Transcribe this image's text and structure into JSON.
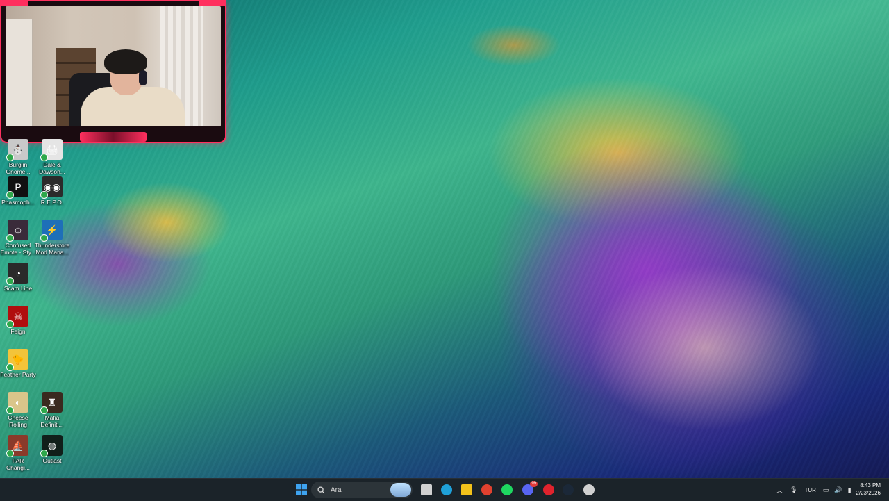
{
  "desktop_icons": [
    {
      "label": "Burglin Gnome...",
      "color": "#c9c9c9",
      "glyph": "⛄"
    },
    {
      "label": "Dale & Dawson...",
      "color": "#e5e5e5",
      "glyph": "🖨"
    },
    {
      "label": "Phasmoph...",
      "color": "#111111",
      "glyph": "P"
    },
    {
      "label": "R.E.P.O.",
      "color": "#2b2b2b",
      "glyph": "◉◉"
    },
    {
      "label": "Confused Emote - Sty...",
      "color": "#3a2b3a",
      "glyph": "☺"
    },
    {
      "label": "Thunderstore Mod Mana...",
      "color": "#1e6fb8",
      "glyph": "⚡"
    },
    {
      "label": "Scam Line",
      "color": "#2a2a2a",
      "glyph": "◔"
    },
    {
      "label": "Feign",
      "color": "#b00e0e",
      "glyph": "☠"
    },
    {
      "label": "Feather Party",
      "color": "#f3c43a",
      "glyph": "🐤"
    },
    {
      "label": "Cheese Rolling",
      "color": "#d9c58a",
      "glyph": "◐"
    },
    {
      "label": "Mafia Definiti...",
      "color": "#3a2a1f",
      "glyph": "♜"
    },
    {
      "label": "FAR Changi...",
      "color": "#8a3a2a",
      "glyph": "⛵"
    },
    {
      "label": "Outlast",
      "color": "#111f1a",
      "glyph": "◍"
    }
  ],
  "taskbar": {
    "search_placeholder": "Ara",
    "apps": [
      {
        "name": "task-view",
        "color": "#d0d0d0"
      },
      {
        "name": "edge",
        "color": "#1fa0d8"
      },
      {
        "name": "file-explorer",
        "color": "#f2c21b"
      },
      {
        "name": "chrome",
        "color": "#e0412f"
      },
      {
        "name": "spotify",
        "color": "#1ed760"
      },
      {
        "name": "discord",
        "color": "#5865f2",
        "badge": "99"
      },
      {
        "name": "opera",
        "color": "#e0232d"
      },
      {
        "name": "steam",
        "color": "#1b2838"
      },
      {
        "name": "obs",
        "color": "#d0d0d0"
      }
    ],
    "tray": {
      "language": "TUR"
    },
    "clock": {
      "time": "8:43 PM",
      "date": "2/23/2026"
    }
  }
}
